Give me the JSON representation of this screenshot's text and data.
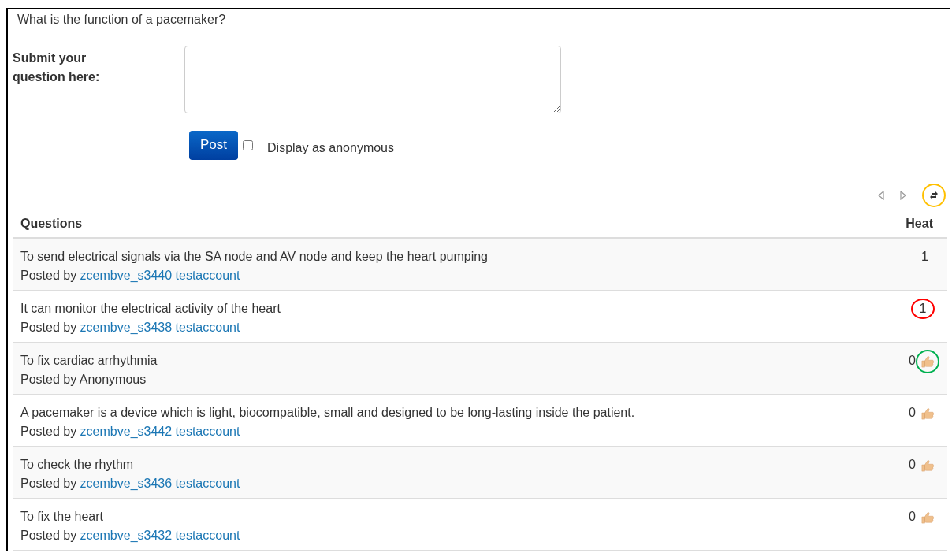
{
  "question": "What is the function of a pacemaker?",
  "form": {
    "label": "Submit your question here:",
    "button": "Post",
    "anonymous": {
      "label": "Display as anonymous",
      "checked": false
    }
  },
  "pager": {
    "refresh_circle": {
      "color": "#ffc000"
    }
  },
  "table": {
    "columns": [
      "Questions",
      "Heat"
    ],
    "rows": [
      {
        "text": "To send electrical signals via the SA node and AV node and keep the heart pumping",
        "prefix": "Posted by",
        "author": "zcembve_s3440 testaccount",
        "author_link": true,
        "heat": "1",
        "thumb": false
      },
      {
        "text": "It can monitor the electrical activity of the heart",
        "prefix": "Posted by",
        "author": "zcembve_s3438 testaccount",
        "author_link": true,
        "heat": "1",
        "thumb": false,
        "heat_circle": {
          "color": "#ff0000"
        }
      },
      {
        "text": "To fix cardiac arrhythmia",
        "prefix": "Posted by",
        "author": "Anonymous",
        "author_link": false,
        "heat": "0",
        "thumb": true,
        "thumb_circle": {
          "color": "#00b050"
        }
      },
      {
        "text": "A pacemaker is a device which is light, biocompatible, small and designed to be long-lasting inside the patient.",
        "prefix": "Posted by",
        "author": "zcembve_s3442 testaccount",
        "author_link": true,
        "heat": "0",
        "thumb": true
      },
      {
        "text": "To check the rhythm",
        "prefix": "Posted by",
        "author": "zcembve_s3436 testaccount",
        "author_link": true,
        "heat": "0",
        "thumb": true
      },
      {
        "text": "To fix the heart",
        "prefix": "Posted by",
        "author": "zcembve_s3432 testaccount",
        "author_link": true,
        "heat": "0",
        "thumb": true
      }
    ]
  }
}
